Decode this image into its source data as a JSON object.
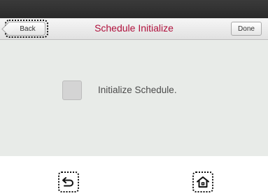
{
  "header": {
    "back_label": "Back",
    "title": "Schedule Initialize",
    "done_label": "Done"
  },
  "content": {
    "checkbox_label": "Initialize Schedule.",
    "checkbox_checked": false
  },
  "navbar": {
    "back_icon": "back-arrow-icon",
    "home_icon": "home-icon"
  },
  "colors": {
    "title": "#b0103c",
    "content_bg": "#e8ebe8",
    "status_bar": "#2f2f2f"
  }
}
